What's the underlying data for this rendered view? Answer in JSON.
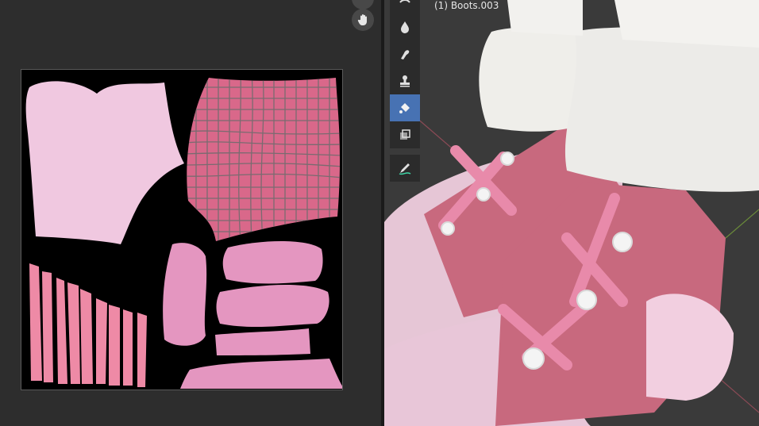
{
  "viewport": {
    "object_label": "(1) Boots.003"
  },
  "toolbar": {
    "tools": [
      {
        "icon": "smear-brush-icon"
      },
      {
        "icon": "blur-drop-icon"
      },
      {
        "icon": "smudge-icon"
      },
      {
        "icon": "clone-stamp-icon"
      },
      {
        "icon": "fill-bucket-icon",
        "active": true
      },
      {
        "icon": "mask-icon"
      },
      {
        "icon": "annotate-pencil-icon"
      }
    ]
  },
  "uv_editor": {
    "nav_icons": [
      "hand-pan-icon"
    ]
  },
  "colors": {
    "accent": "#4772b3",
    "texture_light_pink": "#f0c8e0",
    "texture_mid_pink": "#e496c0",
    "texture_strap_pink": "#ee8aa6",
    "texture_grid_red": "#d9688a"
  }
}
